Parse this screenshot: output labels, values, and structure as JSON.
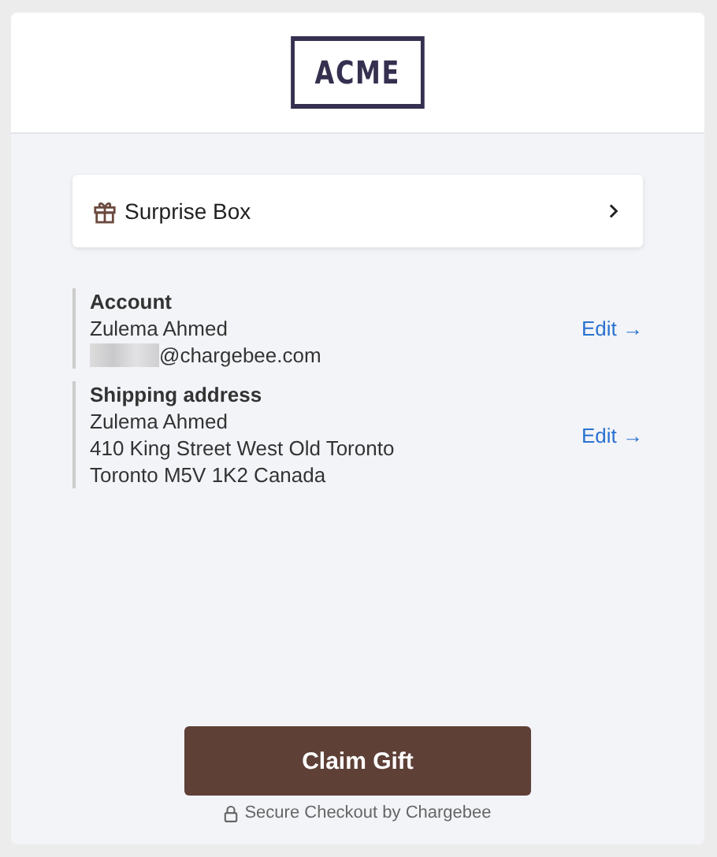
{
  "header": {
    "logo": "ACME"
  },
  "product": {
    "name": "Surprise Box"
  },
  "sections": [
    {
      "title": "Account",
      "lines": [
        "Zulema Ahmed",
        "@chargebee.com"
      ],
      "redacted_prefix": true,
      "action": "Edit →"
    },
    {
      "title": "Shipping address",
      "lines": [
        "Zulema Ahmed",
        "410 King Street West Old Toronto",
        "Toronto M5V 1K2 Canada"
      ],
      "redacted_prefix": false,
      "action": "Edit →"
    }
  ],
  "primary_button": "Claim Gift",
  "footer": "Secure Checkout by Chargebee"
}
